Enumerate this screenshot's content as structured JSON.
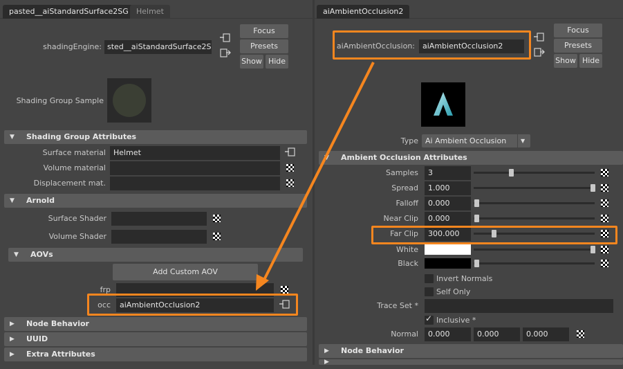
{
  "left": {
    "tabs": [
      "pasted__aiStandardSurface2SG",
      "Helmet"
    ],
    "shading_engine_label": "shadingEngine:",
    "shading_engine_value": "sted__aiStandardSurface2SG",
    "focus": "Focus",
    "presets": "Presets",
    "show": "Show",
    "hide": "Hide",
    "sample_label": "Shading Group Sample",
    "sections": {
      "shading_group": "Shading Group Attributes",
      "arnold": "Arnold",
      "aovs": "AOVs",
      "node_behavior": "Node Behavior",
      "uuid": "UUID",
      "extra": "Extra Attributes"
    },
    "surface_material_label": "Surface material",
    "surface_material_value": "Helmet",
    "volume_material_label": "Volume material",
    "displacement_label": "Displacement mat.",
    "surface_shader_label": "Surface Shader",
    "volume_shader_label": "Volume Shader",
    "add_aov": "Add Custom AOV",
    "frp_label": "frp",
    "occ_label": "occ",
    "occ_value": "aiAmbientOcclusion2"
  },
  "right": {
    "tab": "aiAmbientOcclusion2",
    "node_label": "aiAmbientOcclusion:",
    "node_value": "aiAmbientOcclusion2",
    "focus": "Focus",
    "presets": "Presets",
    "show": "Show",
    "hide": "Hide",
    "type_label": "Type",
    "type_value": "Ai Ambient Occlusion",
    "section_ao": "Ambient Occlusion Attributes",
    "section_node_behavior": "Node Behavior",
    "attrs": {
      "samples": {
        "label": "Samples",
        "value": "3"
      },
      "spread": {
        "label": "Spread",
        "value": "1.000"
      },
      "falloff": {
        "label": "Falloff",
        "value": "0.000"
      },
      "near_clip": {
        "label": "Near Clip",
        "value": "0.000"
      },
      "far_clip": {
        "label": "Far Clip",
        "value": "300.000"
      },
      "white": {
        "label": "White"
      },
      "black": {
        "label": "Black"
      }
    },
    "invert_normals": "Invert Normals",
    "self_only": "Self Only",
    "trace_set_label": "Trace Set *",
    "inclusive": "Inclusive *",
    "normal_label": "Normal",
    "normal": [
      "0.000",
      "0.000",
      "0.000"
    ]
  },
  "colors": {
    "highlight": "#f5861f",
    "panel": "#444444",
    "field": "#2b2b2b",
    "section": "#5b5b5b"
  }
}
